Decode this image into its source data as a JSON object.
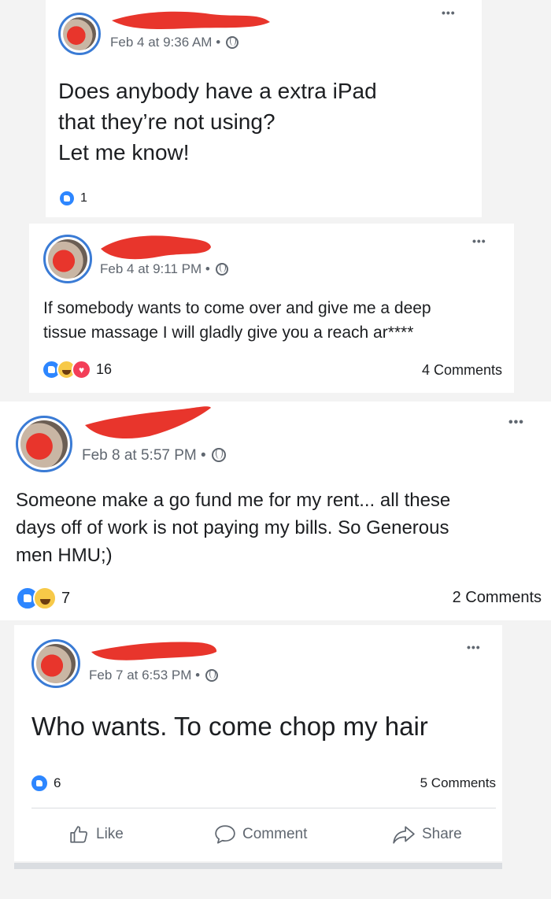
{
  "posts": [
    {
      "timestamp": "Feb 4 at 9:36 AM",
      "text": "Does anybody have a extra iPad\nthat they’re not using?\nLet me know!",
      "reaction_count": "1",
      "reactions": [
        "like"
      ],
      "comments": ""
    },
    {
      "timestamp": "Feb 4 at 9:11 PM",
      "text": "If somebody wants to come over and give me a deep\ntissue massage I will gladly give you a reach ar****",
      "reaction_count": "16",
      "reactions": [
        "like",
        "haha",
        "love"
      ],
      "comments": "4 Comments"
    },
    {
      "timestamp": "Feb 8 at 5:57 PM",
      "text": "Someone make a go fund me for my rent... all these\ndays off of work is not paying my bills. So Generous\nmen HMU;)",
      "reaction_count": "7",
      "reactions": [
        "like",
        "haha"
      ],
      "comments": "2 Comments"
    },
    {
      "timestamp": "Feb 7 at 6:53 PM",
      "text": "Who wants. To come chop my hair",
      "reaction_count": "6",
      "reactions": [
        "like"
      ],
      "comments": "5 Comments"
    }
  ],
  "actions": {
    "like": "Like",
    "comment": "Comment",
    "share": "Share"
  },
  "more_menu": "•••",
  "meta_separator": "•",
  "icons": {
    "privacy": "globe-icon",
    "like_action": "thumbs-up-outline-icon",
    "comment_action": "speech-bubble-icon",
    "share_action": "share-arrow-icon"
  },
  "colors": {
    "accent": "#2d86ff",
    "redaction": "#e8352c",
    "meta_text": "#606770"
  }
}
